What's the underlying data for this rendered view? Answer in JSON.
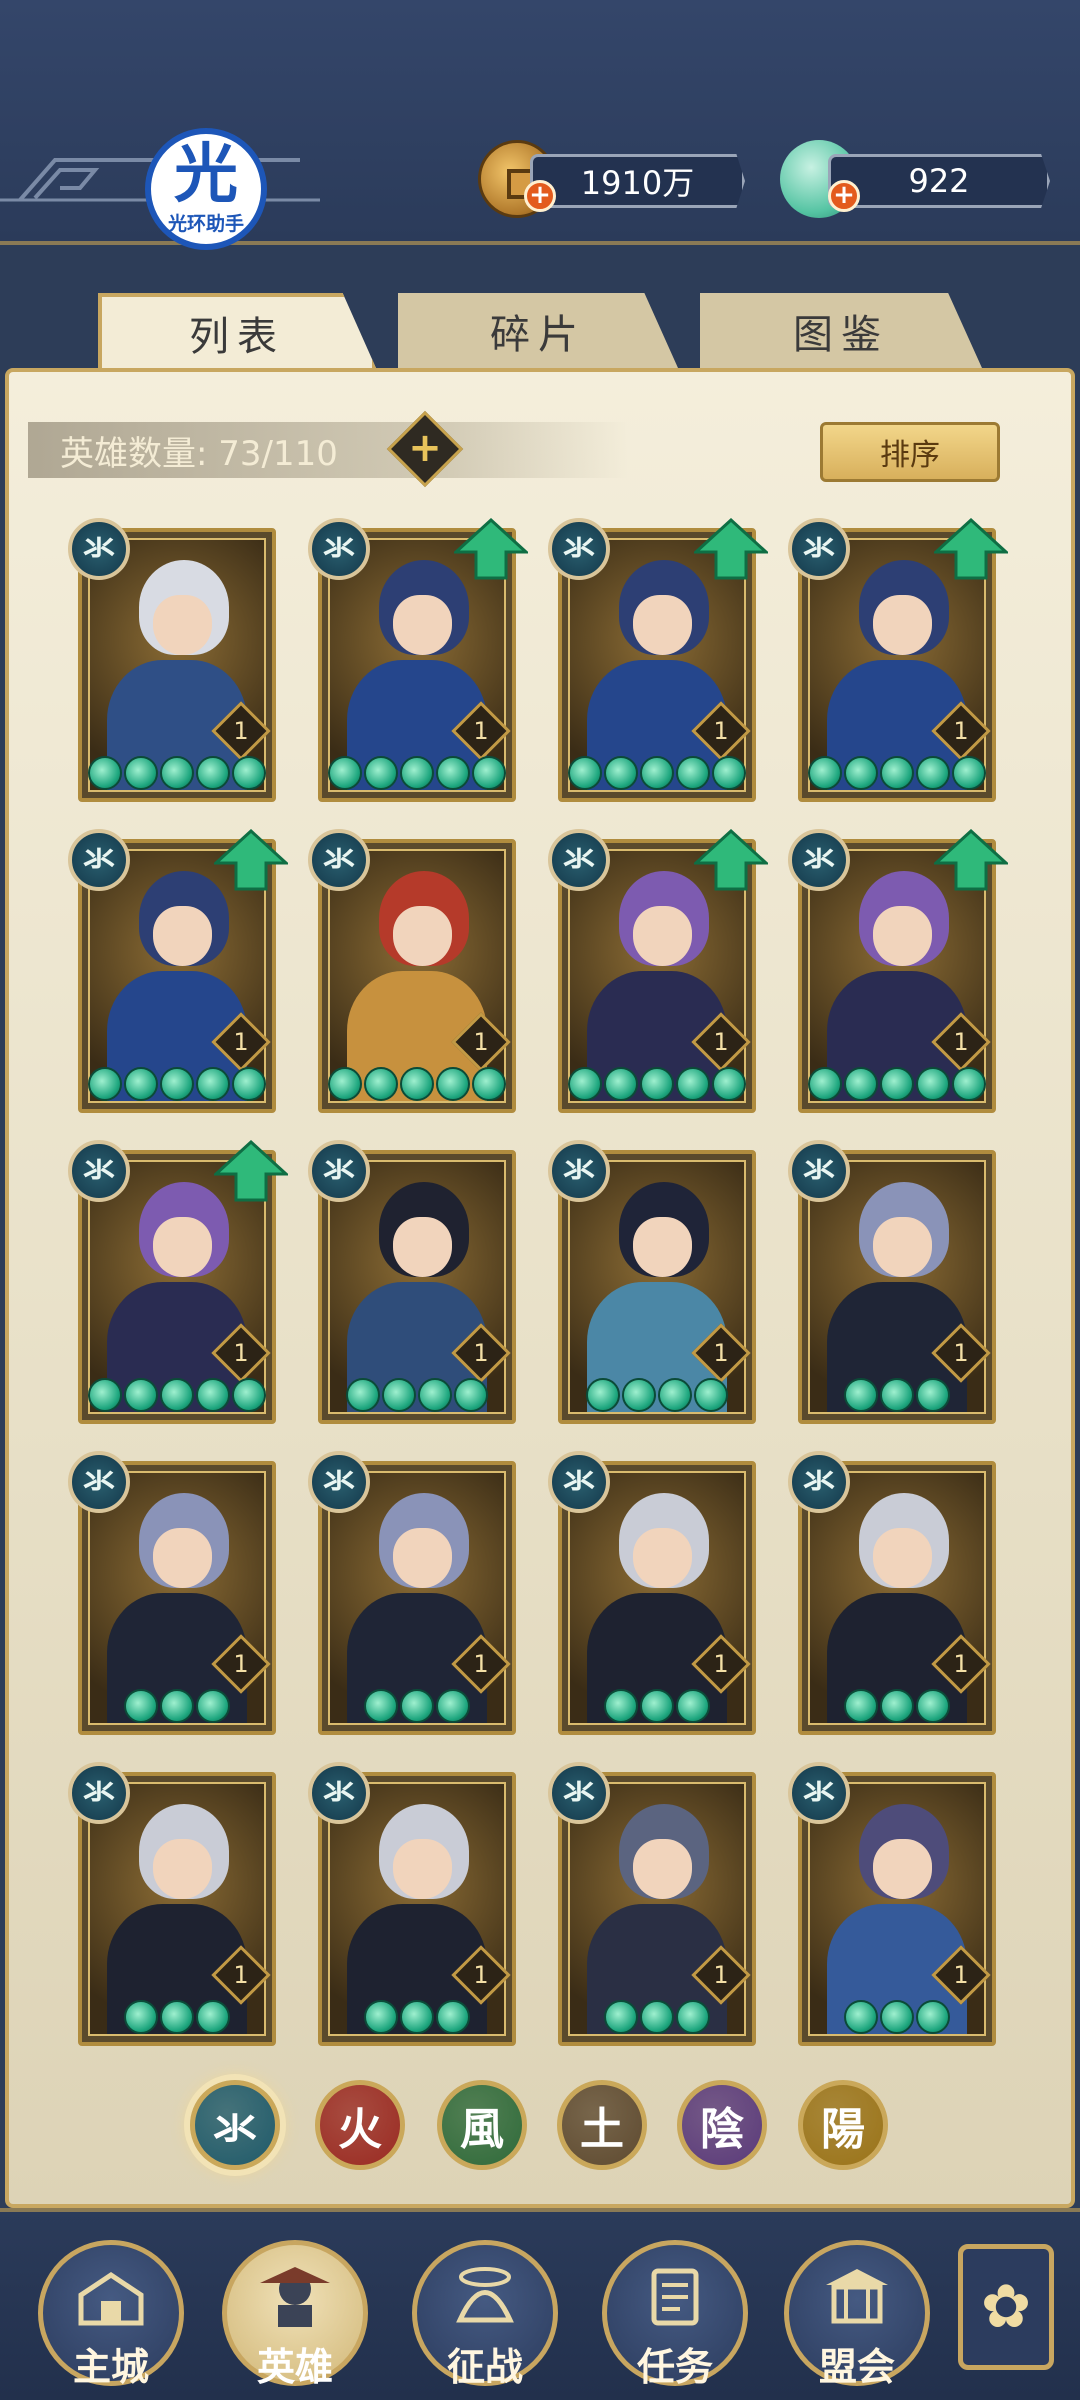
{
  "header": {
    "badge_glyph": "光",
    "badge_caption": "光环助手",
    "resources": [
      {
        "name": "coin",
        "value": "1910万"
      },
      {
        "name": "jade",
        "value": "922"
      }
    ]
  },
  "tabs": [
    {
      "label": "列表",
      "active": true
    },
    {
      "label": "碎片",
      "active": false
    },
    {
      "label": "图鉴",
      "active": false
    }
  ],
  "hero_count": {
    "label": "英雄数量: 73/110"
  },
  "sort_button": "排序",
  "heroes": [
    {
      "element": "氺",
      "level": "1",
      "stars": 5,
      "upgrade": false,
      "palette": "silver"
    },
    {
      "element": "氺",
      "level": "1",
      "stars": 5,
      "upgrade": true,
      "palette": "opera"
    },
    {
      "element": "氺",
      "level": "1",
      "stars": 5,
      "upgrade": true,
      "palette": "opera"
    },
    {
      "element": "氺",
      "level": "1",
      "stars": 5,
      "upgrade": true,
      "palette": "opera"
    },
    {
      "element": "氺",
      "level": "1",
      "stars": 5,
      "upgrade": true,
      "palette": "opera"
    },
    {
      "element": "氺",
      "level": "1",
      "stars": 5,
      "upgrade": false,
      "palette": "red"
    },
    {
      "element": "氺",
      "level": "1",
      "stars": 5,
      "upgrade": true,
      "palette": "violet"
    },
    {
      "element": "氺",
      "level": "1",
      "stars": 5,
      "upgrade": true,
      "palette": "violet"
    },
    {
      "element": "氺",
      "level": "1",
      "stars": 5,
      "upgrade": true,
      "palette": "violet"
    },
    {
      "element": "氺",
      "level": "1",
      "stars": 4,
      "upgrade": false,
      "palette": "dark"
    },
    {
      "element": "氺",
      "level": "1",
      "stars": 4,
      "upgrade": false,
      "palette": "teal"
    },
    {
      "element": "氺",
      "level": "1",
      "stars": 3,
      "upgrade": false,
      "palette": "steel"
    },
    {
      "element": "氺",
      "level": "1",
      "stars": 3,
      "upgrade": false,
      "palette": "steel"
    },
    {
      "element": "氺",
      "level": "1",
      "stars": 3,
      "upgrade": false,
      "palette": "steel"
    },
    {
      "element": "氺",
      "level": "1",
      "stars": 3,
      "upgrade": false,
      "palette": "ninja"
    },
    {
      "element": "氺",
      "level": "1",
      "stars": 3,
      "upgrade": false,
      "palette": "ninja"
    },
    {
      "element": "氺",
      "level": "1",
      "stars": 3,
      "upgrade": false,
      "palette": "ninja"
    },
    {
      "element": "氺",
      "level": "1",
      "stars": 3,
      "upgrade": false,
      "palette": "ninja"
    },
    {
      "element": "氺",
      "level": "1",
      "stars": 3,
      "upgrade": false,
      "palette": "slate"
    },
    {
      "element": "氺",
      "level": "1",
      "stars": 3,
      "upgrade": false,
      "palette": "blue"
    }
  ],
  "element_filter": [
    {
      "glyph": "氺",
      "name": "water",
      "color": "#1f5a6a",
      "selected": true
    },
    {
      "glyph": "火",
      "name": "fire",
      "color": "#9a2a22",
      "selected": false
    },
    {
      "glyph": "風",
      "name": "wind",
      "color": "#2f6a3a",
      "selected": false
    },
    {
      "glyph": "土",
      "name": "earth",
      "color": "#5e4a30",
      "selected": false
    },
    {
      "glyph": "陰",
      "name": "yin",
      "color": "#5a3a7a",
      "selected": false
    },
    {
      "glyph": "陽",
      "name": "yang",
      "color": "#9a7318",
      "selected": false
    }
  ],
  "bottom_nav": [
    {
      "label": "主城",
      "icon": "city-gate-icon",
      "active": false
    },
    {
      "label": "英雄",
      "icon": "hero-portrait-icon",
      "active": true
    },
    {
      "label": "征战",
      "icon": "battle-helmet-icon",
      "active": false
    },
    {
      "label": "任务",
      "icon": "scroll-task-icon",
      "active": false
    },
    {
      "label": "盟会",
      "icon": "alliance-hall-icon",
      "active": false
    }
  ],
  "more_button_icon": "flower-menu-icon"
}
